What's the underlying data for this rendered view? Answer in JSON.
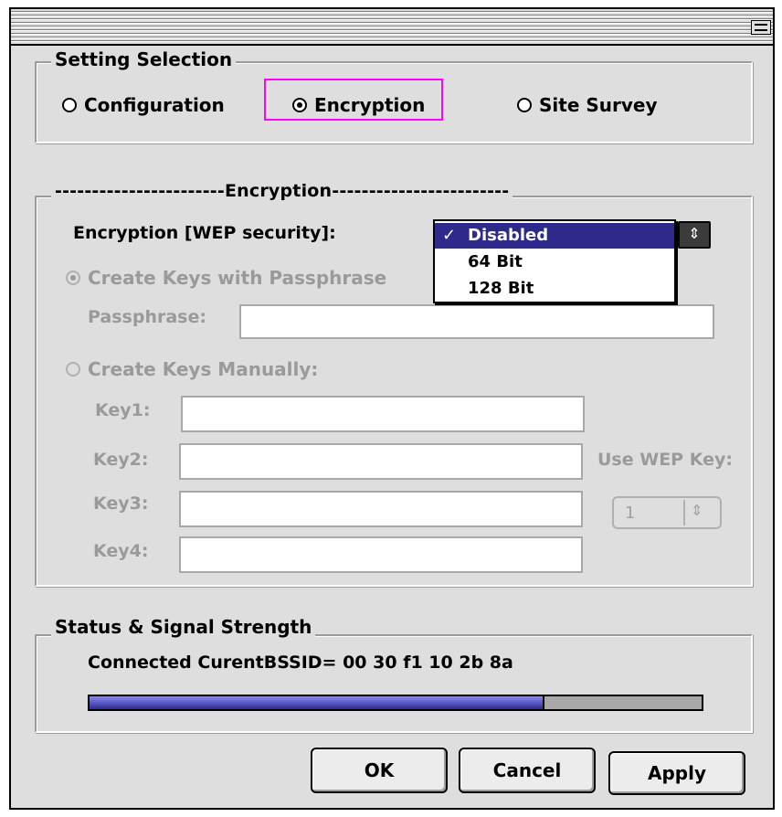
{
  "setting_selection": {
    "title": "Setting Selection",
    "options": [
      {
        "label": "Configuration",
        "selected": false
      },
      {
        "label": "Encryption",
        "selected": true
      },
      {
        "label": "Site Survey",
        "selected": false
      }
    ]
  },
  "encryption": {
    "title": "-----------------------Encryption------------------------",
    "wep_label": "Encryption [WEP security]:",
    "wep_options": [
      "Disabled",
      "64 Bit",
      "128 Bit"
    ],
    "wep_selected": "Disabled",
    "check_mark": "✓",
    "passphrase_radio": "Create Keys with Passphrase",
    "passphrase_label": "Passphrase:",
    "passphrase_value": "",
    "manual_radio": "Create Keys Manually:",
    "keys": [
      {
        "label": "Key1:",
        "value": ""
      },
      {
        "label": "Key2:",
        "value": ""
      },
      {
        "label": "Key3:",
        "value": ""
      },
      {
        "label": "Key4:",
        "value": ""
      }
    ],
    "use_wep_key_label": "Use WEP Key:",
    "use_wep_key_value": "1"
  },
  "status": {
    "title": "Status & Signal Strength",
    "text": "Connected  CurentBSSID= 00 30 f1 10 2b 8a",
    "signal_fraction": 0.74
  },
  "buttons": {
    "ok": "OK",
    "cancel": "Cancel",
    "apply": "Apply"
  },
  "icons": {
    "zoom": "zoom-box-icon",
    "dropdown_arrow": "up-down-arrows-icon",
    "stepper_arrow": "up-down-arrows-icon"
  },
  "colors": {
    "highlight": "#ff00ff",
    "selection": "#2d2a8c",
    "progress": "#5a5ac8"
  }
}
